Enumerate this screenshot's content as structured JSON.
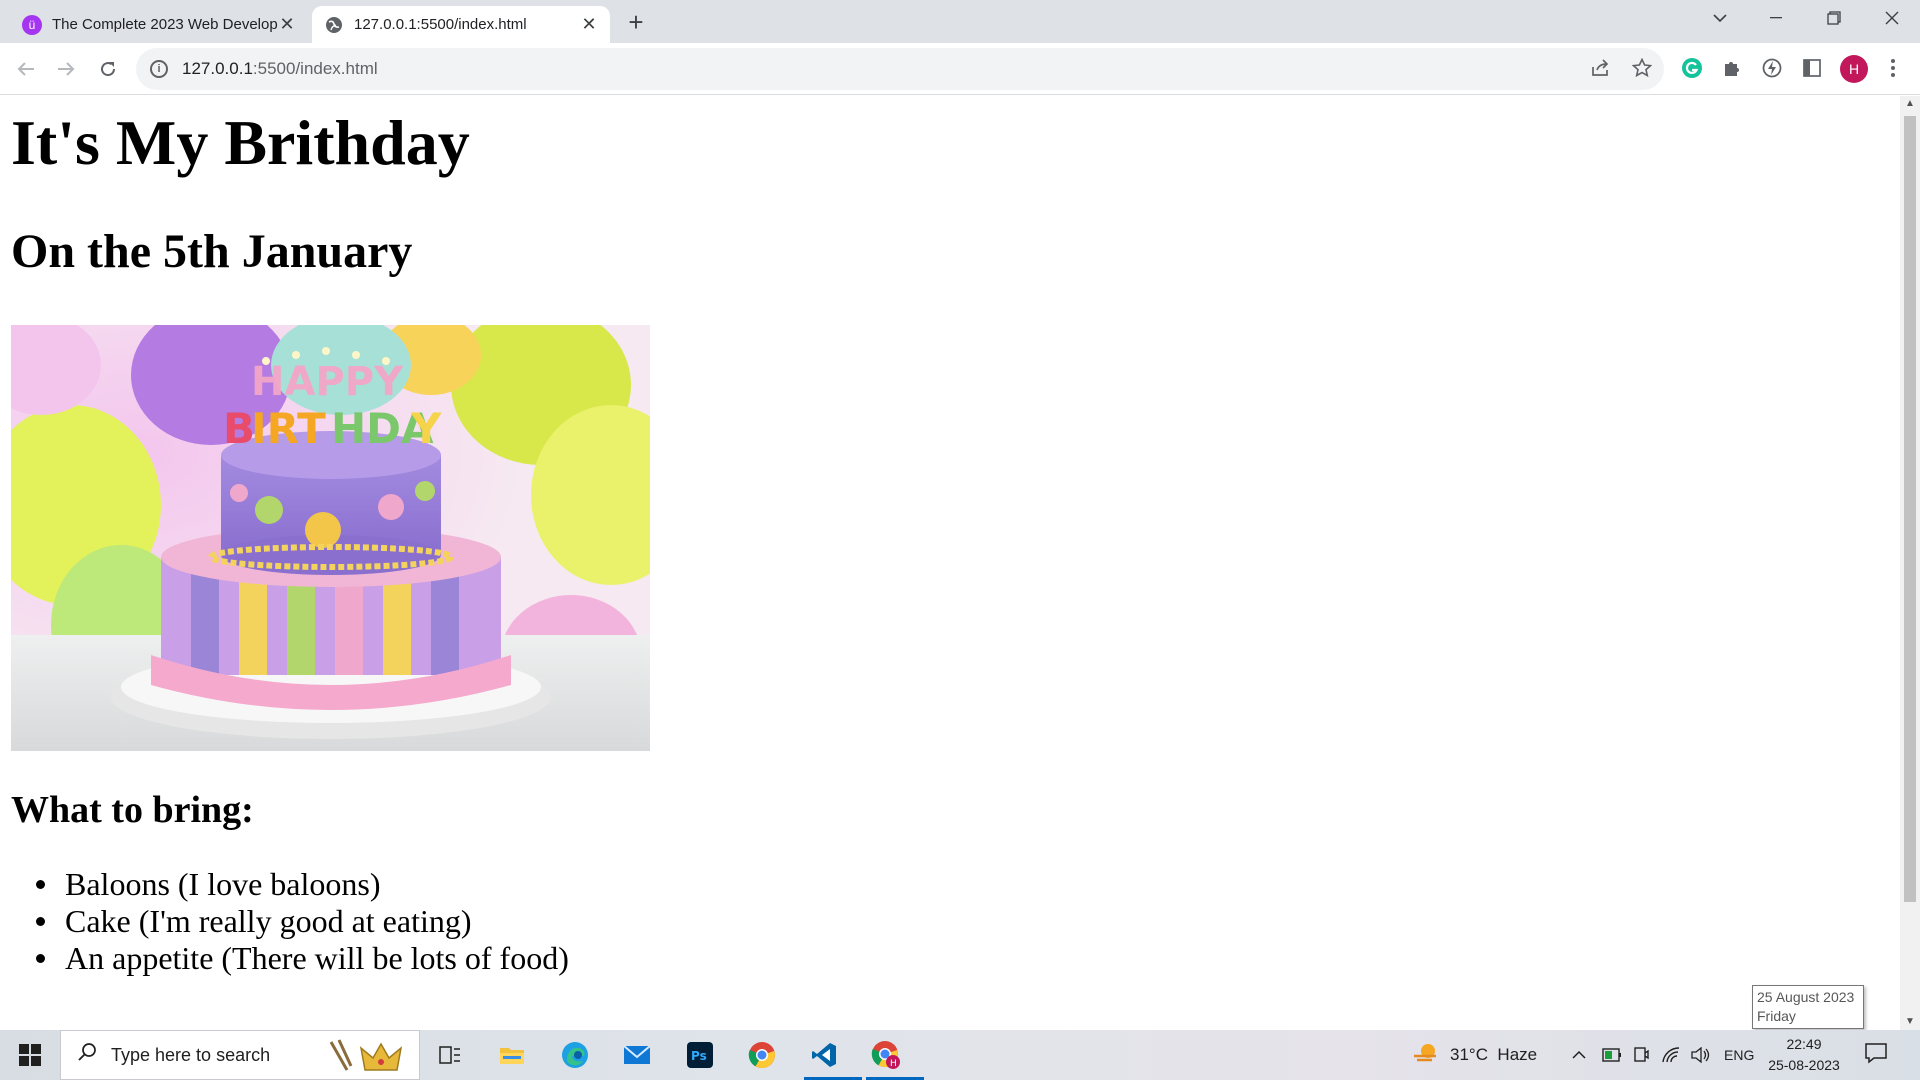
{
  "browser": {
    "tabs": [
      {
        "title": "The Complete 2023 Web Develop",
        "icon": "udemy-icon",
        "active": false
      },
      {
        "title": "127.0.0.1:5500/index.html",
        "icon": "globe-icon",
        "active": true
      }
    ],
    "address": {
      "host": "127.0.0.1",
      "rest": ":5500/index.html"
    },
    "profile_initial": "H",
    "accent": "#c2185b"
  },
  "page": {
    "heading1": "It's My Brithday",
    "heading2": "On the 5th January",
    "image_alt": "HAPPY BIRTHDAY",
    "heading3": "What to bring:",
    "items": [
      "Baloons (I love baloons)",
      "Cake (I'm really good at eating)",
      "An appetite (There will be lots of food)"
    ]
  },
  "tooltip": {
    "date": "25 August 2023",
    "day": "Friday"
  },
  "taskbar": {
    "search_placeholder": "Type here to search",
    "weather": "31°C  Haze",
    "language": "ENG",
    "time": "22:49",
    "date": "25-08-2023"
  }
}
